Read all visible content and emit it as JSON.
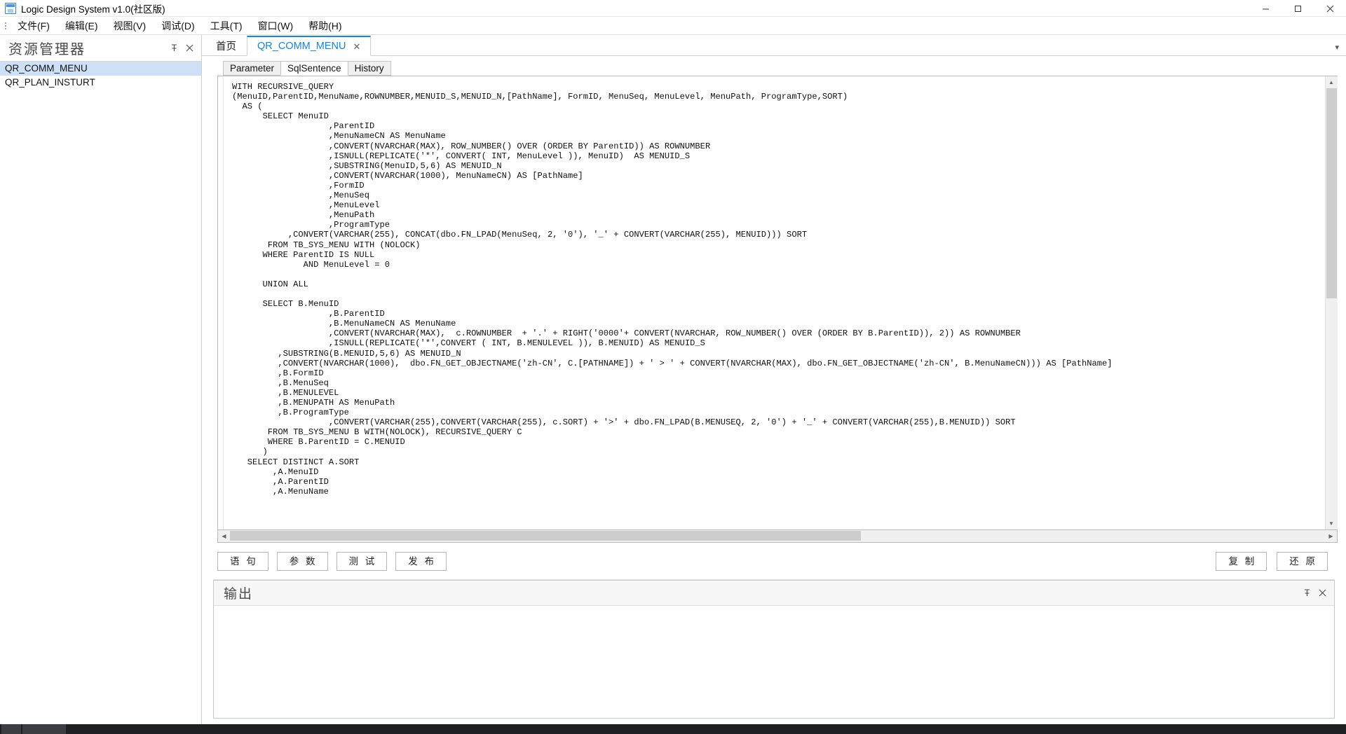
{
  "window": {
    "title": "Logic Design System v1.0(社区版)",
    "icon": "app-window-icon",
    "controls": {
      "minimize": "minimize-icon",
      "maximize": "maximize-icon",
      "close": "close-icon"
    }
  },
  "menubar": {
    "items": [
      {
        "label": "文件(F)",
        "name": "menu-file"
      },
      {
        "label": "编辑(E)",
        "name": "menu-edit"
      },
      {
        "label": "视图(V)",
        "name": "menu-view"
      },
      {
        "label": "调试(D)",
        "name": "menu-debug"
      },
      {
        "label": "工具(T)",
        "name": "menu-tools"
      },
      {
        "label": "窗口(W)",
        "name": "menu-window"
      },
      {
        "label": "帮助(H)",
        "name": "menu-help"
      }
    ]
  },
  "explorer": {
    "title": "资源管理器",
    "pin_icon": "pin-icon",
    "close_icon": "close-icon",
    "items": [
      {
        "label": "QR_COMM_MENU",
        "selected": true
      },
      {
        "label": "QR_PLAN_INSTURT",
        "selected": false
      }
    ]
  },
  "doctabs": {
    "tabs": [
      {
        "label": "首页",
        "active": false,
        "closable": false
      },
      {
        "label": "QR_COMM_MENU",
        "active": true,
        "closable": true,
        "close_icon": "close-icon"
      }
    ],
    "overflow_icon": "chevron-down-icon"
  },
  "subtabs": [
    {
      "label": "Parameter",
      "active": false
    },
    {
      "label": "SqlSentence",
      "active": true
    },
    {
      "label": "History",
      "active": false
    }
  ],
  "editor": {
    "language": "sql",
    "scrollbar": {
      "up_icon": "chevron-up-icon",
      "down_icon": "chevron-down-icon",
      "left_icon": "chevron-left-icon",
      "right_icon": "chevron-right-icon"
    },
    "sql": "WITH RECURSIVE_QUERY\n(MenuID,ParentID,MenuName,ROWNUMBER,MENUID_S,MENUID_N,[PathName], FormID, MenuSeq, MenuLevel, MenuPath, ProgramType,SORT)\n  AS (\n      SELECT MenuID\n                   ,ParentID\n                   ,MenuNameCN AS MenuName\n                   ,CONVERT(NVARCHAR(MAX), ROW_NUMBER() OVER (ORDER BY ParentID)) AS ROWNUMBER\n                   ,ISNULL(REPLICATE('*', CONVERT( INT, MenuLevel )), MenuID)  AS MENUID_S\n                   ,SUBSTRING(MenuID,5,6) AS MENUID_N\n                   ,CONVERT(NVARCHAR(1000), MenuNameCN) AS [PathName]\n                   ,FormID\n                   ,MenuSeq\n                   ,MenuLevel\n                   ,MenuPath\n                   ,ProgramType\n           ,CONVERT(VARCHAR(255), CONCAT(dbo.FN_LPAD(MenuSeq, 2, '0'), '_' + CONVERT(VARCHAR(255), MENUID))) SORT\n       FROM TB_SYS_MENU WITH (NOLOCK)\n      WHERE ParentID IS NULL\n              AND MenuLevel = 0\n\n      UNION ALL\n\n      SELECT B.MenuID\n                   ,B.ParentID\n                   ,B.MenuNameCN AS MenuName\n                   ,CONVERT(NVARCHAR(MAX),  c.ROWNUMBER  + '.' + RIGHT('0000'+ CONVERT(NVARCHAR, ROW_NUMBER() OVER (ORDER BY B.ParentID)), 2)) AS ROWNUMBER\n                   ,ISNULL(REPLICATE('*',CONVERT ( INT, B.MENULEVEL )), B.MENUID) AS MENUID_S\n         ,SUBSTRING(B.MENUID,5,6) AS MENUID_N\n         ,CONVERT(NVARCHAR(1000),  dbo.FN_GET_OBJECTNAME('zh-CN', C.[PATHNAME]) + ' > ' + CONVERT(NVARCHAR(MAX), dbo.FN_GET_OBJECTNAME('zh-CN', B.MenuNameCN))) AS [PathName]\n         ,B.FormID\n         ,B.MenuSeq\n         ,B.MENULEVEL\n         ,B.MENUPATH AS MenuPath\n         ,B.ProgramType\n                   ,CONVERT(VARCHAR(255),CONVERT(VARCHAR(255), c.SORT) + '>' + dbo.FN_LPAD(B.MENUSEQ, 2, '0') + '_' + CONVERT(VARCHAR(255),B.MENUID)) SORT\n       FROM TB_SYS_MENU B WITH(NOLOCK), RECURSIVE_QUERY C\n       WHERE B.ParentID = C.MENUID\n      )\n   SELECT DISTINCT A.SORT\n        ,A.MenuID\n        ,A.ParentID\n        ,A.MenuName"
  },
  "actions": {
    "left": [
      {
        "label": "语 句",
        "name": "statement-button"
      },
      {
        "label": "参 数",
        "name": "parameter-button"
      },
      {
        "label": "测 试",
        "name": "test-button"
      },
      {
        "label": "发 布",
        "name": "publish-button"
      }
    ],
    "right": [
      {
        "label": "复 制",
        "name": "copy-button"
      },
      {
        "label": "还 原",
        "name": "restore-button"
      }
    ]
  },
  "output": {
    "title": "输出",
    "pin_icon": "pin-icon",
    "close_icon": "close-icon",
    "content": ""
  },
  "colors": {
    "accent": "#1585d8",
    "selection": "#cde0f5",
    "panel_bg": "#f7f7f7",
    "border": "#c8c8c8"
  }
}
